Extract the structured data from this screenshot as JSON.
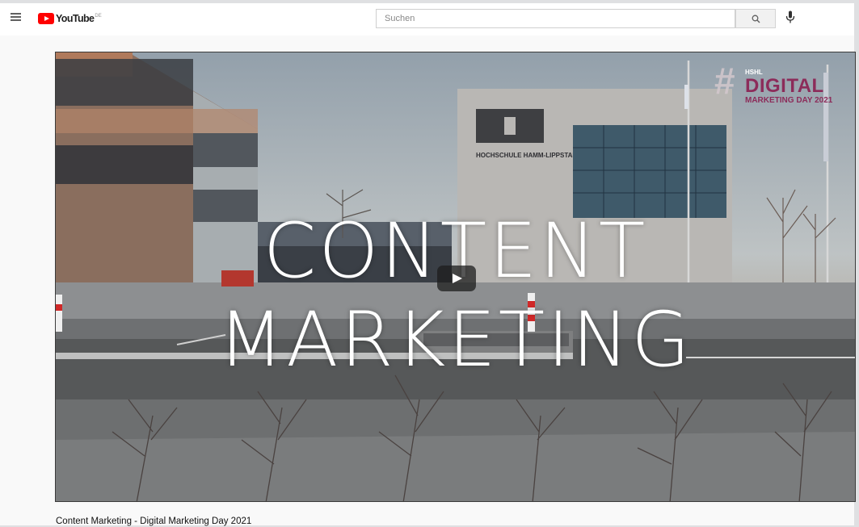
{
  "header": {
    "logo_text": "YouTube",
    "country_code": "DE",
    "search_placeholder": "Suchen"
  },
  "video": {
    "overlay_title": "CONTENT MARKETING",
    "brand": {
      "hash": "#",
      "org": "HSHL",
      "word": "DIGITAL",
      "subtitle": "MARKETING DAY 2021"
    },
    "building_sign": "HOCHSCHULE HAMM-LIPPSTADT",
    "title": "Content Marketing - Digital Marketing Day 2021"
  },
  "colors": {
    "youtube_red": "#ff0000",
    "brand_magenta": "#8c2c5a"
  }
}
